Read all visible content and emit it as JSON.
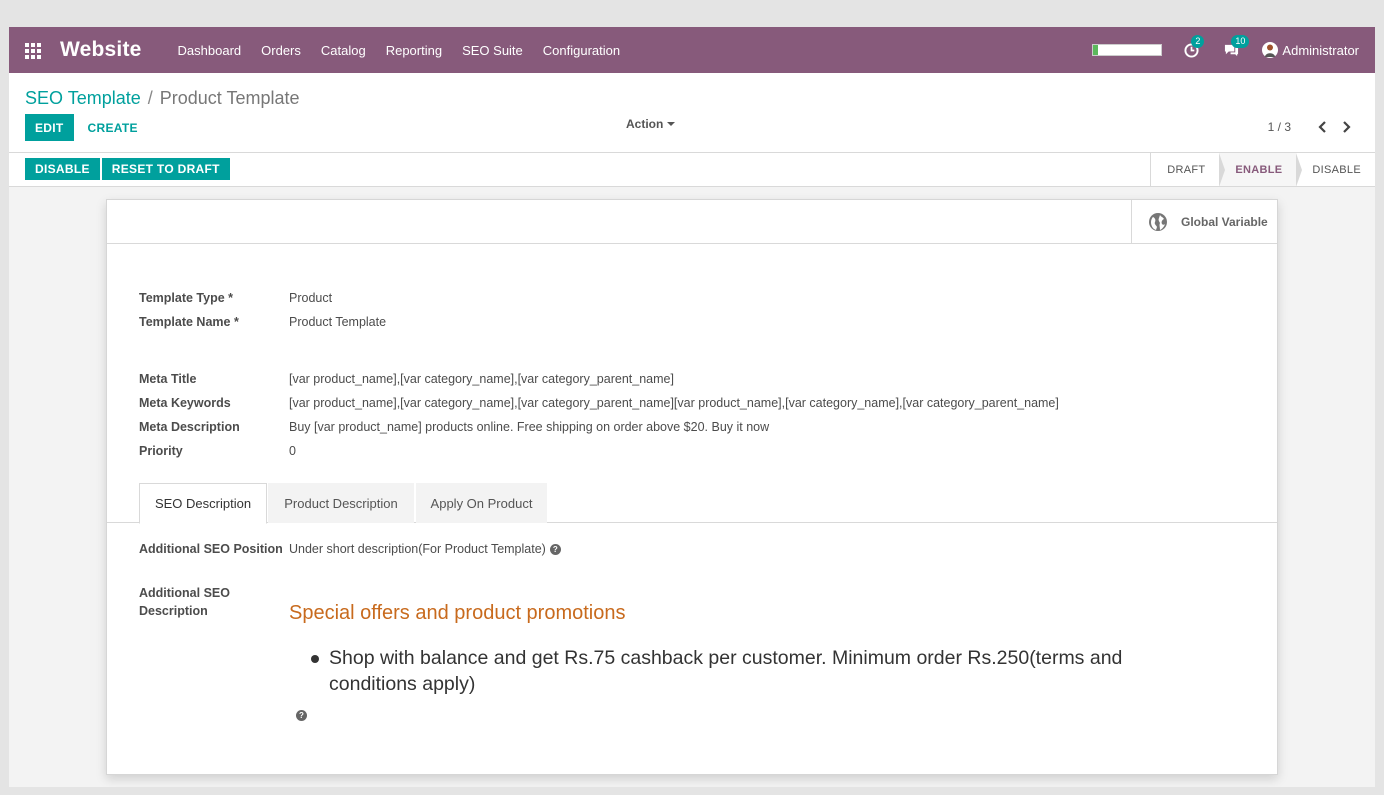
{
  "topbar": {
    "brand": "Website",
    "menu": [
      "Dashboard",
      "Orders",
      "Catalog",
      "Reporting",
      "SEO Suite",
      "Configuration"
    ],
    "activity_count": "2",
    "messages_count": "10",
    "user": "Administrator",
    "progress_fraction": 0.07
  },
  "breadcrumb": {
    "parent": "SEO Template",
    "separator": "/",
    "current": "Product Template"
  },
  "control_panel": {
    "edit_label": "EDIT",
    "create_label": "CREATE",
    "action_label": "Action",
    "pager": "1 / 3"
  },
  "statusbar": {
    "disable_label": "DISABLE",
    "reset_label": "RESET TO DRAFT",
    "stages": [
      "DRAFT",
      "ENABLE",
      "DISABLE"
    ],
    "active_stage": "ENABLE"
  },
  "smart_button": {
    "label": "Global Variable"
  },
  "fields": {
    "template_type": {
      "label": "Template Type *",
      "value": "Product"
    },
    "template_name": {
      "label": "Template Name *",
      "value": "Product Template"
    },
    "meta_title": {
      "label": "Meta Title",
      "value": "[var product_name],[var category_name],[var category_parent_name]"
    },
    "meta_keywords": {
      "label": "Meta Keywords",
      "value": "[var product_name],[var category_name],[var category_parent_name][var product_name],[var category_name],[var category_parent_name]"
    },
    "meta_description": {
      "label": "Meta Description",
      "value": "Buy [var product_name] products online. Free shipping on order above $20. Buy it now"
    },
    "priority": {
      "label": "Priority",
      "value": "0"
    }
  },
  "tabs": [
    "SEO Description",
    "Product Description",
    "Apply On Product"
  ],
  "seo_tab": {
    "position_label": "Additional SEO Position",
    "position_value": "Under short description(For Product Template)",
    "description_label_1": "Additional SEO",
    "description_label_2": "Description",
    "heading": "Special offers and product promotions",
    "bullets": [
      "Shop with balance and get Rs.75 cashback per customer. Minimum order Rs.250(terms and conditions apply)"
    ]
  },
  "colors": {
    "brand": "#875a7b",
    "accent": "#00a09d",
    "heading": "#c86a1d"
  }
}
